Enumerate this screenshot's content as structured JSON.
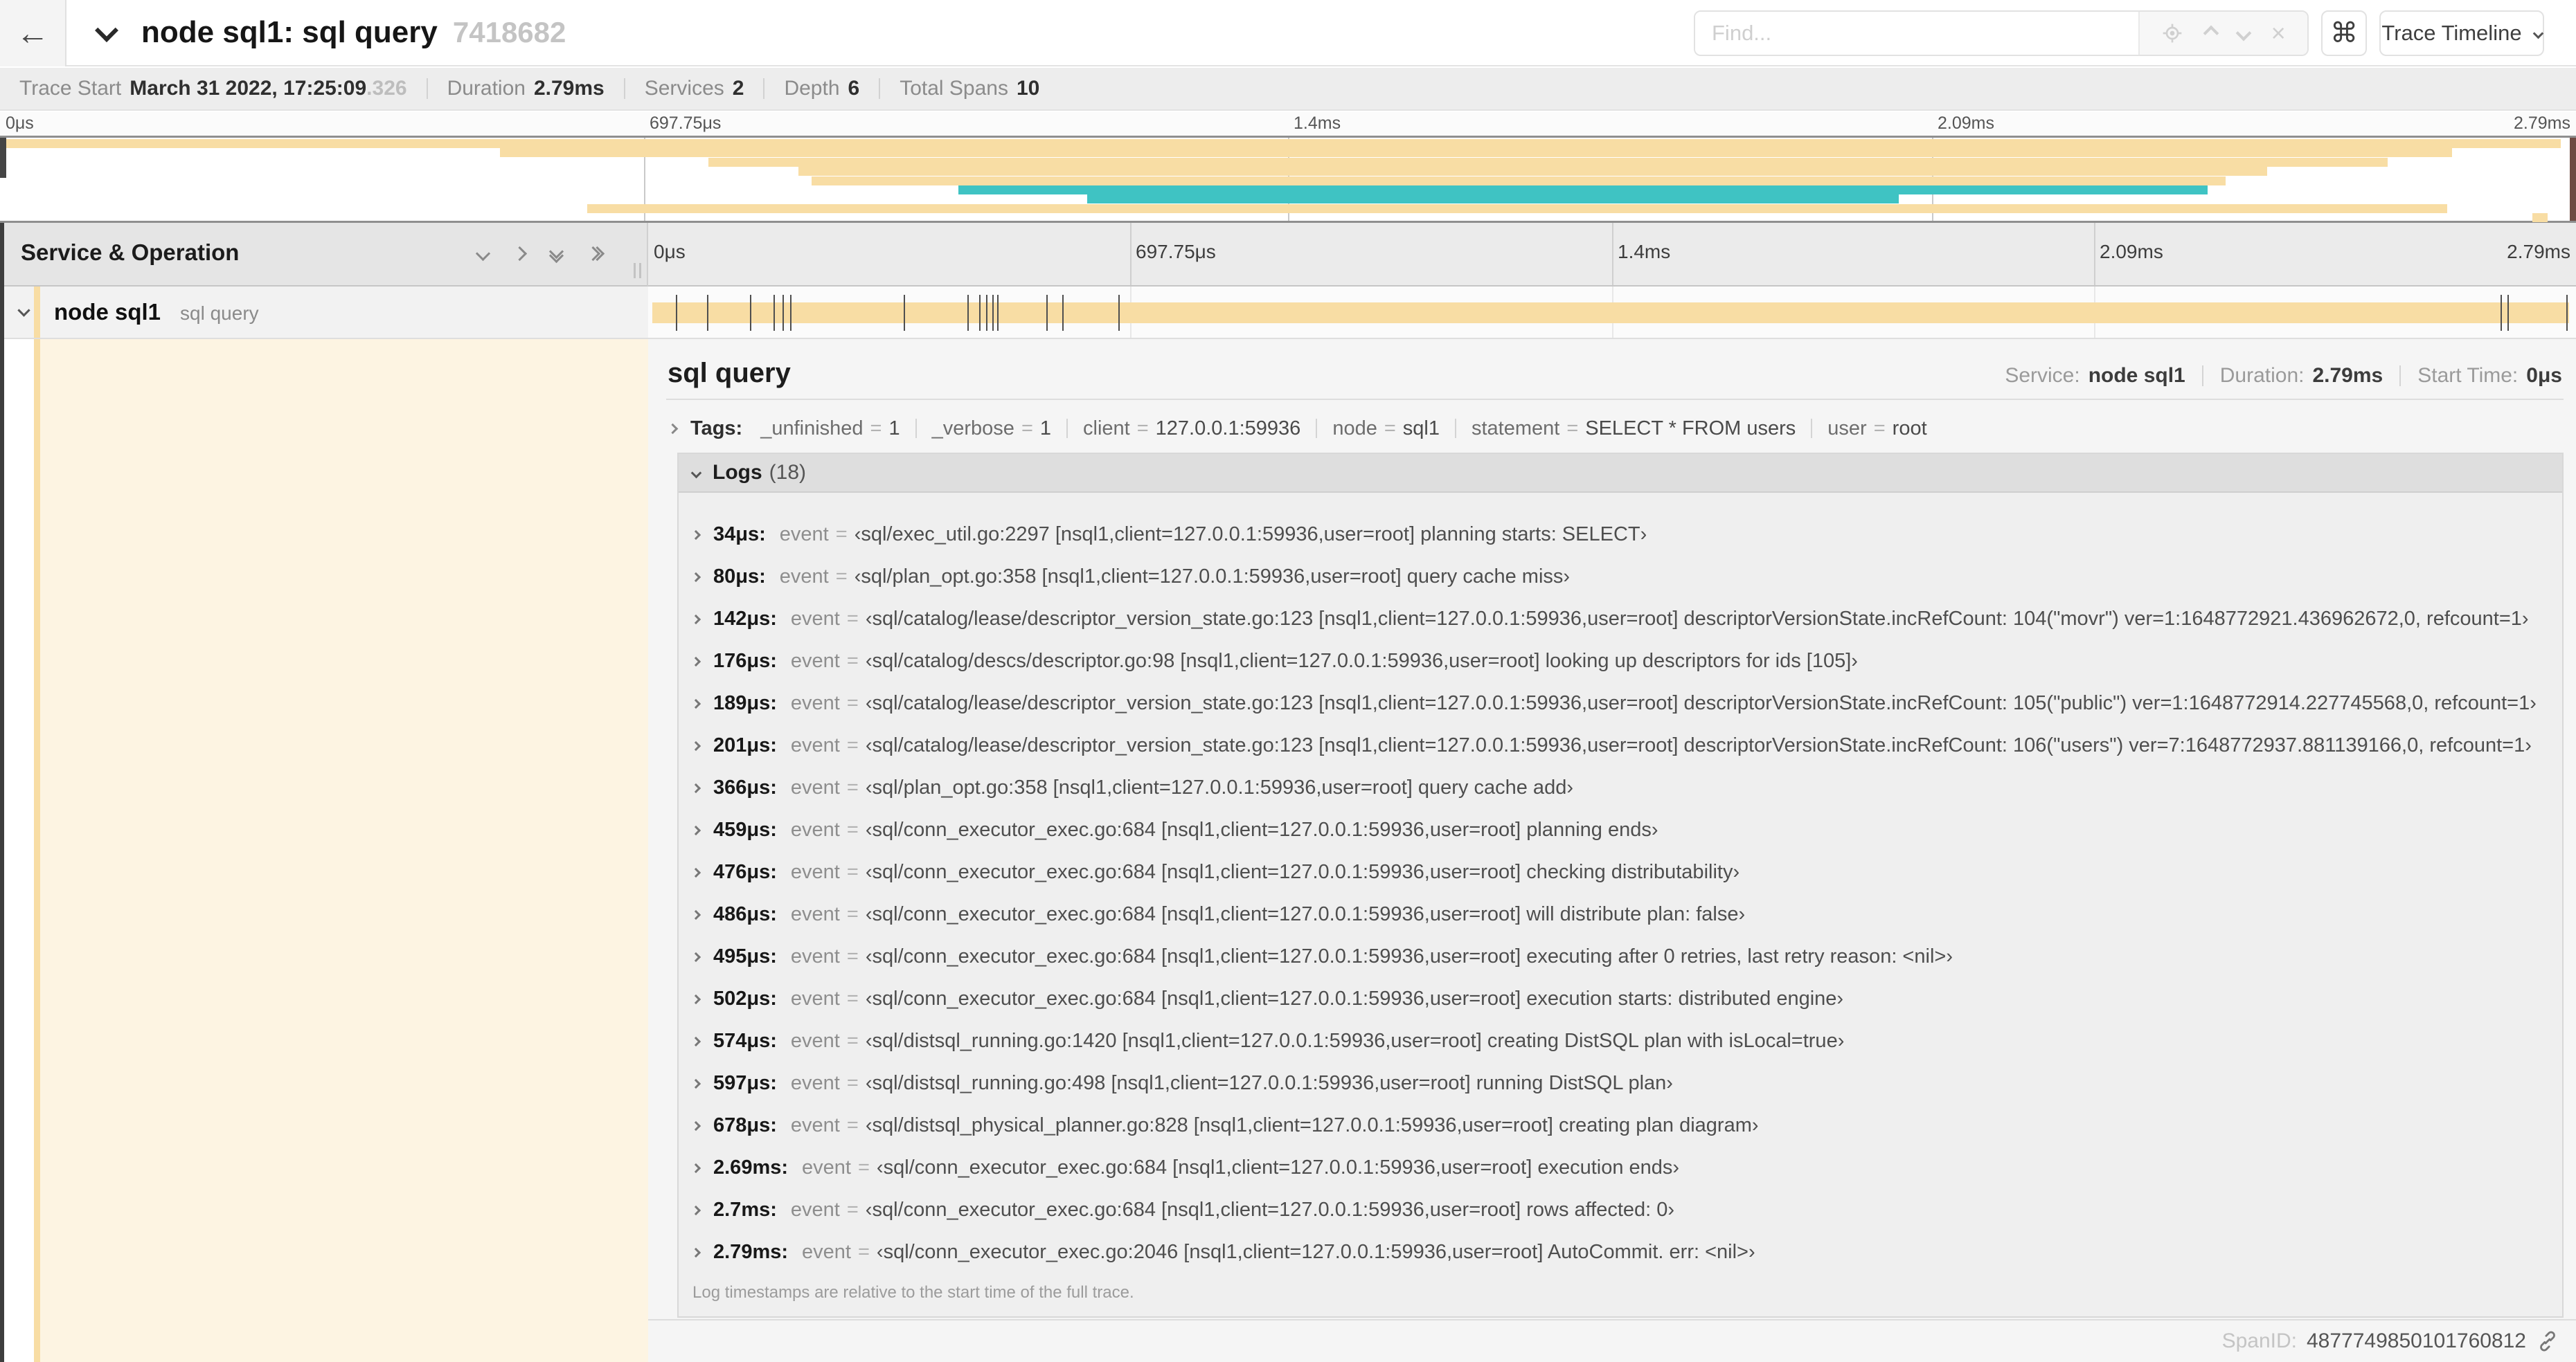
{
  "header": {
    "back_glyph": "←",
    "title": "node sql1: sql query",
    "trace_id": "7418682",
    "find_placeholder": "Find...",
    "clear_glyph": "×",
    "shortcut_glyph": "⌘",
    "view_selector": "Trace Timeline"
  },
  "trace_info": {
    "items": [
      {
        "label": "Trace Start",
        "value": "March 31 2022, 17:25:09",
        "suffix": ".326"
      },
      {
        "label": "Duration",
        "value": "2.79ms"
      },
      {
        "label": "Services",
        "value": "2"
      },
      {
        "label": "Depth",
        "value": "6"
      },
      {
        "label": "Total Spans",
        "value": "10"
      }
    ]
  },
  "timeline": {
    "total_us": 2790,
    "ticks": [
      {
        "label": "0μs",
        "pct": 0
      },
      {
        "label": "697.75μs",
        "pct": 25
      },
      {
        "label": "1.4ms",
        "pct": 50
      },
      {
        "label": "2.09ms",
        "pct": 75
      },
      {
        "label": "2.79ms",
        "pct": 100
      }
    ],
    "gridlines_pct": [
      25,
      50,
      75
    ],
    "minimap_spans": [
      {
        "start": 0,
        "end": 99.4,
        "color": "tan"
      },
      {
        "start": 19.4,
        "end": 95.2,
        "color": "tan"
      },
      {
        "start": 27.5,
        "end": 92.7,
        "color": "tan"
      },
      {
        "start": 31.0,
        "end": 88.0,
        "color": "tan"
      },
      {
        "start": 31.5,
        "end": 86.4,
        "color": "tan"
      },
      {
        "start": 37.2,
        "end": 85.7,
        "color": "teal"
      },
      {
        "start": 42.2,
        "end": 73.7,
        "color": "teal"
      },
      {
        "start": 22.8,
        "end": 95.0,
        "color": "tan"
      },
      {
        "start": 98.3,
        "end": 98.9,
        "color": "tan"
      }
    ]
  },
  "span_row": {
    "service": "node sql1",
    "operation": "sql query",
    "log_marker_us": [
      34,
      80,
      142,
      176,
      189,
      201,
      366,
      459,
      476,
      486,
      495,
      502,
      574,
      597,
      678,
      2690,
      2700,
      2790
    ]
  },
  "detail": {
    "operation": "sql query",
    "service_label": "Service:",
    "service": "node sql1",
    "duration_label": "Duration:",
    "duration": "2.79ms",
    "start_label": "Start Time:",
    "start": "0μs",
    "tags_label": "Tags:",
    "tags": [
      {
        "key": "_unfinished",
        "value": "1"
      },
      {
        "key": "_verbose",
        "value": "1"
      },
      {
        "key": "client",
        "value": "127.0.0.1:59936"
      },
      {
        "key": "node",
        "value": "sql1"
      },
      {
        "key": "statement",
        "value": "SELECT * FROM users"
      },
      {
        "key": "user",
        "value": "root"
      }
    ],
    "logs_label": "Logs",
    "logs_count": "(18)",
    "logs": [
      {
        "time": "34μs:",
        "key": "event",
        "value": "‹sql/exec_util.go:2297 [nsql1,client=127.0.0.1:59936,user=root] planning starts: SELECT›"
      },
      {
        "time": "80μs:",
        "key": "event",
        "value": "‹sql/plan_opt.go:358 [nsql1,client=127.0.0.1:59936,user=root] query cache miss›"
      },
      {
        "time": "142μs:",
        "key": "event",
        "value": "‹sql/catalog/lease/descriptor_version_state.go:123 [nsql1,client=127.0.0.1:59936,user=root] descriptorVersionState.incRefCount: 104(\"movr\") ver=1:1648772921.436962672,0, refcount=1›"
      },
      {
        "time": "176μs:",
        "key": "event",
        "value": "‹sql/catalog/descs/descriptor.go:98 [nsql1,client=127.0.0.1:59936,user=root] looking up descriptors for ids [105]›"
      },
      {
        "time": "189μs:",
        "key": "event",
        "value": "‹sql/catalog/lease/descriptor_version_state.go:123 [nsql1,client=127.0.0.1:59936,user=root] descriptorVersionState.incRefCount: 105(\"public\") ver=1:1648772914.227745568,0, refcount=1›"
      },
      {
        "time": "201μs:",
        "key": "event",
        "value": "‹sql/catalog/lease/descriptor_version_state.go:123 [nsql1,client=127.0.0.1:59936,user=root] descriptorVersionState.incRefCount: 106(\"users\") ver=7:1648772937.881139166,0, refcount=1›"
      },
      {
        "time": "366μs:",
        "key": "event",
        "value": "‹sql/plan_opt.go:358 [nsql1,client=127.0.0.1:59936,user=root] query cache add›"
      },
      {
        "time": "459μs:",
        "key": "event",
        "value": "‹sql/conn_executor_exec.go:684 [nsql1,client=127.0.0.1:59936,user=root] planning ends›"
      },
      {
        "time": "476μs:",
        "key": "event",
        "value": "‹sql/conn_executor_exec.go:684 [nsql1,client=127.0.0.1:59936,user=root] checking distributability›"
      },
      {
        "time": "486μs:",
        "key": "event",
        "value": "‹sql/conn_executor_exec.go:684 [nsql1,client=127.0.0.1:59936,user=root] will distribute plan: false›"
      },
      {
        "time": "495μs:",
        "key": "event",
        "value": "‹sql/conn_executor_exec.go:684 [nsql1,client=127.0.0.1:59936,user=root] executing after 0 retries, last retry reason: <nil>›"
      },
      {
        "time": "502μs:",
        "key": "event",
        "value": "‹sql/conn_executor_exec.go:684 [nsql1,client=127.0.0.1:59936,user=root] execution starts: distributed engine›"
      },
      {
        "time": "574μs:",
        "key": "event",
        "value": "‹sql/distsql_running.go:1420 [nsql1,client=127.0.0.1:59936,user=root] creating DistSQL plan with isLocal=true›"
      },
      {
        "time": "597μs:",
        "key": "event",
        "value": "‹sql/distsql_running.go:498 [nsql1,client=127.0.0.1:59936,user=root] running DistSQL plan›"
      },
      {
        "time": "678μs:",
        "key": "event",
        "value": "‹sql/distsql_physical_planner.go:828 [nsql1,client=127.0.0.1:59936,user=root] creating plan diagram›"
      },
      {
        "time": "2.69ms:",
        "key": "event",
        "value": "‹sql/conn_executor_exec.go:684 [nsql1,client=127.0.0.1:59936,user=root] execution ends›"
      },
      {
        "time": "2.7ms:",
        "key": "event",
        "value": "‹sql/conn_executor_exec.go:684 [nsql1,client=127.0.0.1:59936,user=root] rows affected: 0›"
      },
      {
        "time": "2.79ms:",
        "key": "event",
        "value": "‹sql/conn_executor_exec.go:2046 [nsql1,client=127.0.0.1:59936,user=root] AutoCommit. err: <nil>›"
      }
    ],
    "logs_note": "Log timestamps are relative to the start time of the full trace.",
    "span_id_label": "SpanID:",
    "span_id": "4877749850101760812"
  },
  "colors": {
    "tan": "#f8dda4",
    "teal": "#3fc3c3",
    "cream": "#fdf4e2",
    "scrubber_left": "#454545",
    "scrubber_right": "#6f4a42"
  }
}
